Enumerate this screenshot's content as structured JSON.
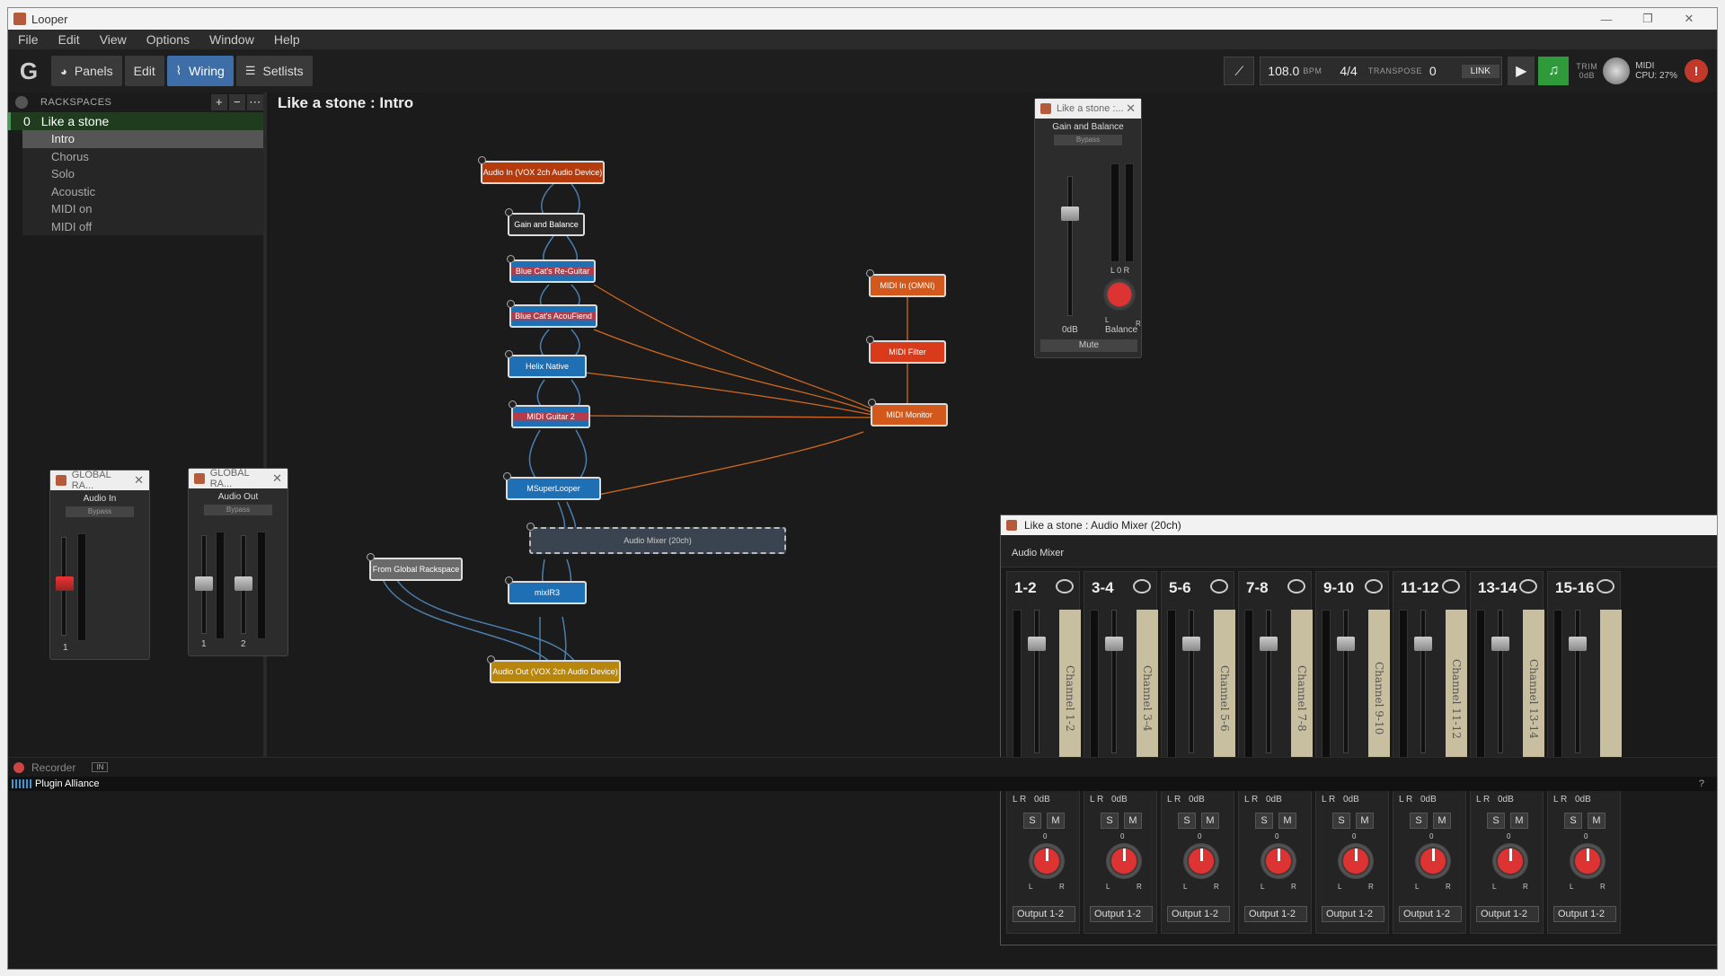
{
  "window": {
    "title": "Looper"
  },
  "menu": [
    "File",
    "Edit",
    "View",
    "Options",
    "Window",
    "Help"
  ],
  "toolbar": {
    "buttons": [
      {
        "label": "Panels",
        "icon": "palette-icon"
      },
      {
        "label": "Edit"
      },
      {
        "label": "Wiring",
        "icon": "wiring-icon"
      },
      {
        "label": "Setlists",
        "icon": "list-icon"
      }
    ],
    "tempo": "108.0",
    "bpm_label": "BPM",
    "time_sig": "4/4",
    "transpose_label": "TRANSPOSE",
    "transpose": "0",
    "link": "LINK",
    "trim_label": "TRIM",
    "trim_value": "0dB",
    "midi_label": "MIDI",
    "cpu_label": "CPU:",
    "cpu": "27%"
  },
  "sidebar": {
    "header": "RACKSPACES",
    "rackspace": {
      "num": "0",
      "name": "Like a stone"
    },
    "variations": [
      "Intro",
      "Chorus",
      "Solo",
      "Acoustic",
      "MIDI on",
      "MIDI off"
    ],
    "selected": 0
  },
  "wiring": {
    "title": "Like a stone : Intro",
    "nodes": [
      "Audio In (VOX 2ch Audio Device)",
      "Gain and Balance",
      "Blue Cat's Re-Guitar",
      "Blue Cat's AcouFiend",
      "Helix Native",
      "MIDI Guitar 2",
      "MSuperLooper",
      "Audio Mixer (20ch)",
      "mixIR3",
      "From Global Rackspace",
      "Audio Out (VOX 2ch Audio Device)",
      "MIDI In (OMNI)",
      "MIDI Filter",
      "MIDI Monitor"
    ]
  },
  "gain_panel": {
    "title": "Like a stone :...",
    "name": "Gain and Balance",
    "bypass": "Bypass",
    "level": "0dB",
    "lr": "L 0 R",
    "balance": "Balance",
    "l": "L",
    "r": "R",
    "mute": "Mute"
  },
  "global_in": {
    "title": "GLOBAL RA...",
    "name": "Audio In",
    "bypass": "Bypass",
    "ch1": "1"
  },
  "global_out": {
    "title": "GLOBAL RA...",
    "name": "Audio Out",
    "bypass": "Bypass",
    "ch1": "1",
    "ch2": "2"
  },
  "mixer": {
    "title": "Like a stone : Audio Mixer (20ch)",
    "subtitle": "Audio Mixer",
    "strips": [
      {
        "name": "1-2",
        "channel": "Channel 1-2"
      },
      {
        "name": "3-4",
        "channel": "Channel 3-4"
      },
      {
        "name": "5-6",
        "channel": "Channel 5-6"
      },
      {
        "name": "7-8",
        "channel": "Channel 7-8"
      },
      {
        "name": "9-10",
        "channel": "Channel 9-10"
      },
      {
        "name": "11-12",
        "channel": "Channel 11-12"
      },
      {
        "name": "13-14",
        "channel": "Channel 13-14"
      },
      {
        "name": "15-16",
        "channel": ""
      }
    ],
    "lr": "L R",
    "level": "0dB",
    "s": "S",
    "m": "M",
    "pan_zero": "0",
    "l": "L",
    "r": "R",
    "output": "Output 1-2"
  },
  "status": {
    "recorder": "Recorder",
    "in": "IN",
    "brand": "Plugin Alliance"
  },
  "colors": {
    "accent": "#3d6ea8",
    "rack_green": "#2fa84a",
    "audio_node": "#b53a0c",
    "plugin_node": "#1f6fb5",
    "wire_audio": "#4a7fb0",
    "wire_midi": "#d2691e"
  }
}
